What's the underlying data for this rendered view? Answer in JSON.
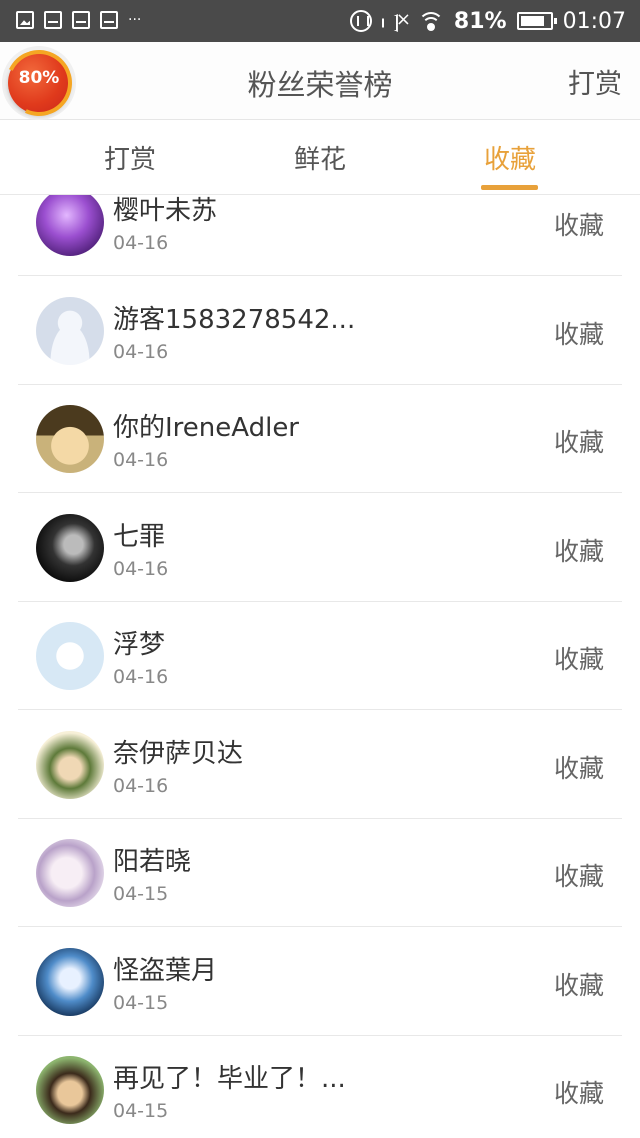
{
  "status_bar": {
    "battery_percent": "81%",
    "battery_level": 0.81,
    "time": "01:07",
    "dots": "···"
  },
  "header": {
    "badge_text": "80%",
    "title": "粉丝荣誉榜",
    "action": "打赏"
  },
  "tabs": [
    {
      "label": "打赏",
      "active": false
    },
    {
      "label": "鲜花",
      "active": false
    },
    {
      "label": "收藏",
      "active": true
    }
  ],
  "accent_color": "#e8a13a",
  "list": [
    {
      "name": "樱叶未苏",
      "date": "04-16",
      "action": "收藏",
      "avatar": "purple-anime-avatar"
    },
    {
      "name": "游客1583278542...",
      "date": "04-16",
      "action": "收藏",
      "avatar": "default-user-avatar"
    },
    {
      "name": "你的IreneAdler",
      "date": "04-16",
      "action": "收藏",
      "avatar": "anime-boy-avatar"
    },
    {
      "name": "七罪",
      "date": "04-16",
      "action": "收藏",
      "avatar": "dark-portrait-avatar"
    },
    {
      "name": "浮梦",
      "date": "04-16",
      "action": "收藏",
      "avatar": "qq-logo-avatar"
    },
    {
      "name": "奈伊萨贝达",
      "date": "04-16",
      "action": "收藏",
      "avatar": "green-hood-avatar"
    },
    {
      "name": "阳若晓",
      "date": "04-15",
      "action": "收藏",
      "avatar": "pastel-girl-avatar"
    },
    {
      "name": "怪盗葉月",
      "date": "04-15",
      "action": "收藏",
      "avatar": "blue-anime-avatar"
    },
    {
      "name": "再见了！毕业了！...",
      "date": "04-15",
      "action": "收藏",
      "avatar": "child-photo-avatar"
    }
  ]
}
